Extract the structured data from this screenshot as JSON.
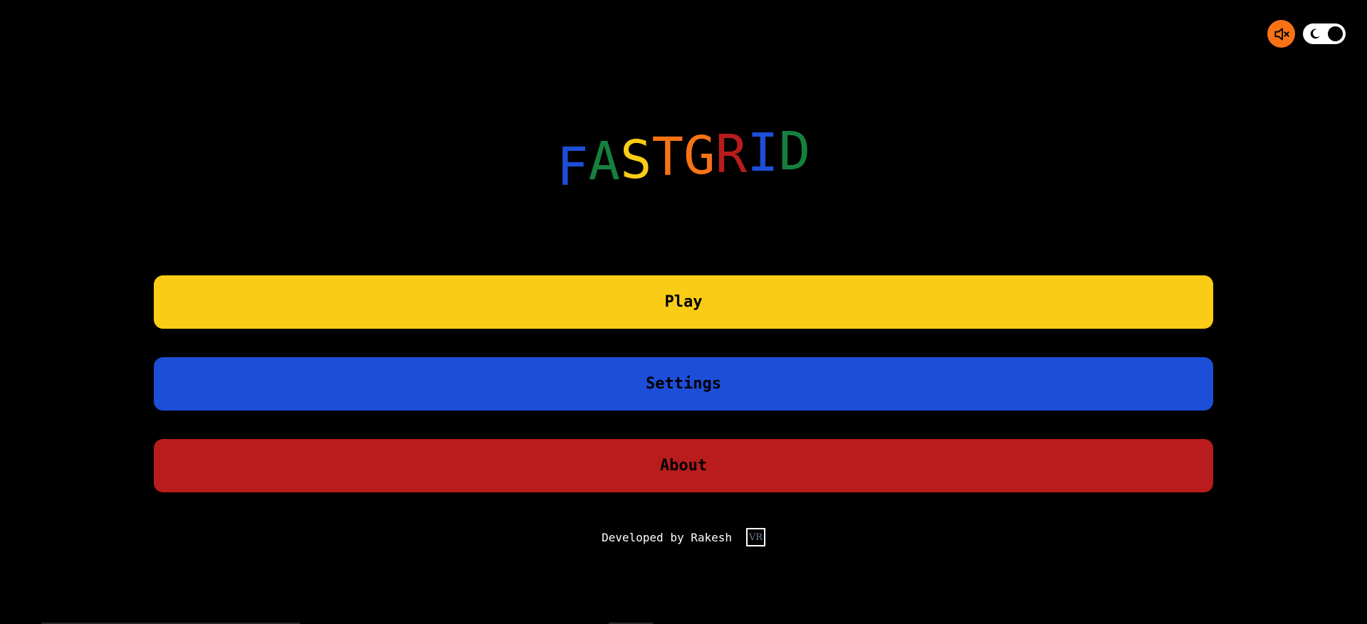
{
  "header": {
    "mute_icon": "speaker-muted-icon",
    "theme_icon": "moon-icon",
    "accent_color": "#f97316"
  },
  "title": {
    "letters": [
      "F",
      "A",
      "S",
      "T",
      "G",
      "R",
      "I",
      "D"
    ],
    "colors": [
      "#1d4ed8",
      "#15803d",
      "#facc15",
      "#f97316",
      "#f97316",
      "#b91c1c",
      "#1d4ed8",
      "#15803d"
    ]
  },
  "menu": {
    "play_label": "Play",
    "play_color": "#facc15",
    "settings_label": "Settings",
    "settings_color": "#1d4ed8",
    "about_label": "About",
    "about_color": "#b91c1c"
  },
  "footer": {
    "credit_text": "Developed by Rakesh",
    "logo_text": "VR"
  }
}
